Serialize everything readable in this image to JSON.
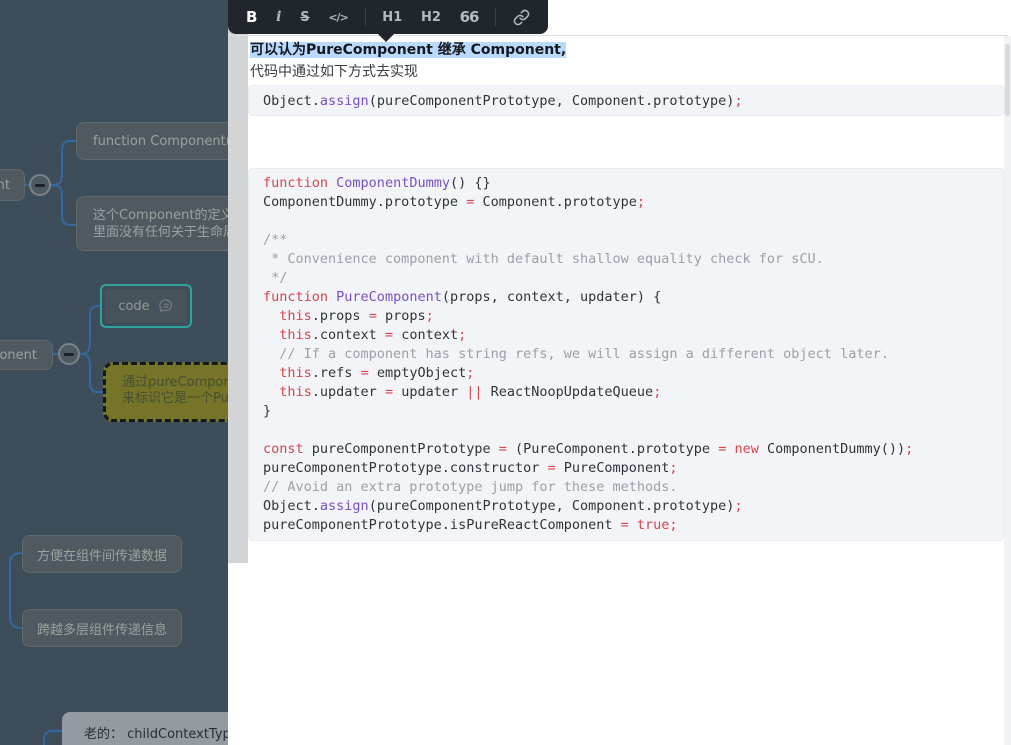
{
  "toolbar": {
    "bold_label": "B",
    "italic_label": "i",
    "strike_label": "S",
    "code_label": "</>",
    "h1_label": "H1",
    "h2_label": "H2",
    "quote_label": "66"
  },
  "editor": {
    "selected_text": "可以认为PureComponent 继承 Component,",
    "paragraph2": "代码中通过如下方式去实现",
    "selection_color": "#b9d9fd",
    "code_block_1": {
      "lines": [
        [
          [
            "p",
            "Object."
          ],
          [
            "f",
            "assign"
          ],
          [
            "p",
            "(pureComponentPrototype, Component.prototype)"
          ],
          [
            "k",
            ";"
          ]
        ]
      ]
    },
    "code_block_2": {
      "lines": [
        [
          [
            "k",
            "function"
          ],
          [
            "p",
            " "
          ],
          [
            "f",
            "ComponentDummy"
          ],
          [
            "p",
            "() {}"
          ]
        ],
        [
          [
            "p",
            "ComponentDummy.prototype "
          ],
          [
            "k",
            "="
          ],
          [
            "p",
            " Component.prototype"
          ],
          [
            "k",
            ";"
          ]
        ],
        [],
        [
          [
            "c",
            "/**"
          ]
        ],
        [
          [
            "c",
            " * Convenience component with default shallow equality check for sCU."
          ]
        ],
        [
          [
            "c",
            " */"
          ]
        ],
        [
          [
            "k",
            "function"
          ],
          [
            "p",
            " "
          ],
          [
            "f",
            "PureComponent"
          ],
          [
            "p",
            "(props, context, updater) {"
          ]
        ],
        [
          [
            "p",
            "  "
          ],
          [
            "k",
            "this"
          ],
          [
            "p",
            ".props "
          ],
          [
            "k",
            "="
          ],
          [
            "p",
            " props"
          ],
          [
            "k",
            ";"
          ]
        ],
        [
          [
            "p",
            "  "
          ],
          [
            "k",
            "this"
          ],
          [
            "p",
            ".context "
          ],
          [
            "k",
            "="
          ],
          [
            "p",
            " context"
          ],
          [
            "k",
            ";"
          ]
        ],
        [
          [
            "c",
            "  // If a component has string refs, we will assign a different object later."
          ]
        ],
        [
          [
            "p",
            "  "
          ],
          [
            "k",
            "this"
          ],
          [
            "p",
            ".refs "
          ],
          [
            "k",
            "="
          ],
          [
            "p",
            " emptyObject"
          ],
          [
            "k",
            ";"
          ]
        ],
        [
          [
            "p",
            "  "
          ],
          [
            "k",
            "this"
          ],
          [
            "p",
            ".updater "
          ],
          [
            "k",
            "="
          ],
          [
            "p",
            " updater "
          ],
          [
            "k",
            "||"
          ],
          [
            "p",
            " ReactNoopUpdateQueue"
          ],
          [
            "k",
            ";"
          ]
        ],
        [
          [
            "p",
            "}"
          ]
        ],
        [],
        [
          [
            "k",
            "const"
          ],
          [
            "p",
            " pureComponentPrototype "
          ],
          [
            "k",
            "="
          ],
          [
            "p",
            " (PureComponent.prototype "
          ],
          [
            "k",
            "="
          ],
          [
            "p",
            " "
          ],
          [
            "k",
            "new"
          ],
          [
            "p",
            " ComponentDummy())"
          ],
          [
            "k",
            ";"
          ]
        ],
        [
          [
            "p",
            "pureComponentPrototype.constructor "
          ],
          [
            "k",
            "="
          ],
          [
            "p",
            " PureComponent"
          ],
          [
            "k",
            ";"
          ]
        ],
        [
          [
            "c",
            "// Avoid an extra prototype jump for these methods."
          ]
        ],
        [
          [
            "p",
            "Object."
          ],
          [
            "f",
            "assign"
          ],
          [
            "p",
            "(pureComponentPrototype, Component.prototype)"
          ],
          [
            "k",
            ";"
          ]
        ],
        [
          [
            "p",
            "pureComponentPrototype.isPureReactComponent "
          ],
          [
            "k",
            "="
          ],
          [
            "p",
            " "
          ],
          [
            "k",
            "true"
          ],
          [
            "k",
            ";"
          ]
        ]
      ]
    }
  },
  "code_colors": {
    "plain": "#2f353b",
    "keyword": "#d5454f",
    "function": "#7a4fc1",
    "comment": "#9ba1a9"
  },
  "mindmap": {
    "nodes": {
      "component_cropped": "nt",
      "function_component": "function Component(p",
      "definition_line1": "这个Component的定义",
      "definition_line2": "里面没有任何关于生命周",
      "purecomponent_cropped": "ponent",
      "code": "code",
      "pure_note_line1": "通过pureCompone",
      "pure_note_line2": "来标识它是一个Pu",
      "benefit1": "方便在组件间传递数据",
      "benefit2": "跨越多层组件传递信息",
      "old_context": "老的： childContextType"
    },
    "colors": {
      "background": "#3d4e5a",
      "node_fill": "#4e5a5f",
      "node_text": "#99a39e",
      "connector": "#35689f",
      "selection_border": "#2fa39c",
      "highlight_fill": "#767428",
      "highlight_border": "#15191c",
      "highlight_text": "#454f31",
      "light_node_fill": "#949aa0",
      "light_node_text": "#272e35"
    }
  }
}
